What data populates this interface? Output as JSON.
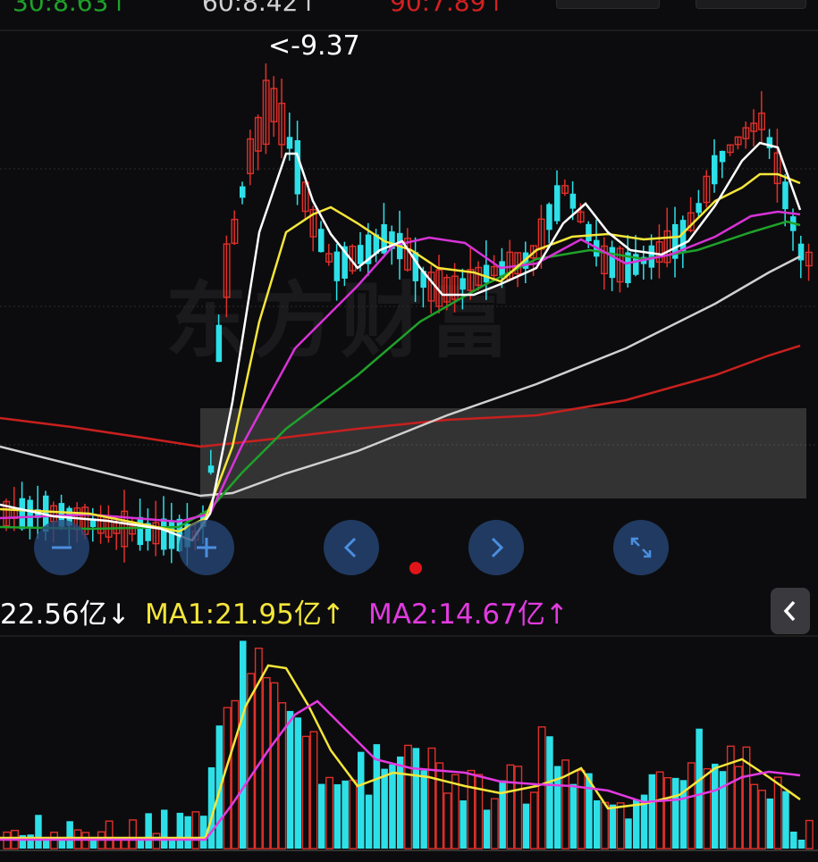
{
  "legend": {
    "ma30": "30:8.63↑",
    "ma60": "60:8.42↑",
    "ma90": "90:7.89↑",
    "ma30_color": "#1fa12a",
    "ma60_color": "#d0d0d0",
    "ma90_color": "#d42020"
  },
  "peak_label": "<-9.37",
  "watermark": "东方财富",
  "volume_legend": {
    "vol": "22.56亿↓",
    "ma1": "MA1:21.95亿↑",
    "ma2": "MA2:14.67亿↑",
    "ma1_color": "#f5e63a",
    "ma2_color": "#e23ae0"
  },
  "colors": {
    "up": "#e0302a",
    "down": "#2de0e8",
    "ma5": "#ffffff",
    "ma10": "#f5e63a",
    "ma20": "#d733d6",
    "ma30": "#1fa12a",
    "ma60": "#d0d0d0",
    "ma90": "#c8201e"
  },
  "nav_icons": [
    "zoom-out-icon",
    "zoom-in-icon",
    "scroll-left-icon",
    "scroll-right-icon",
    "fullscreen-icon"
  ]
}
